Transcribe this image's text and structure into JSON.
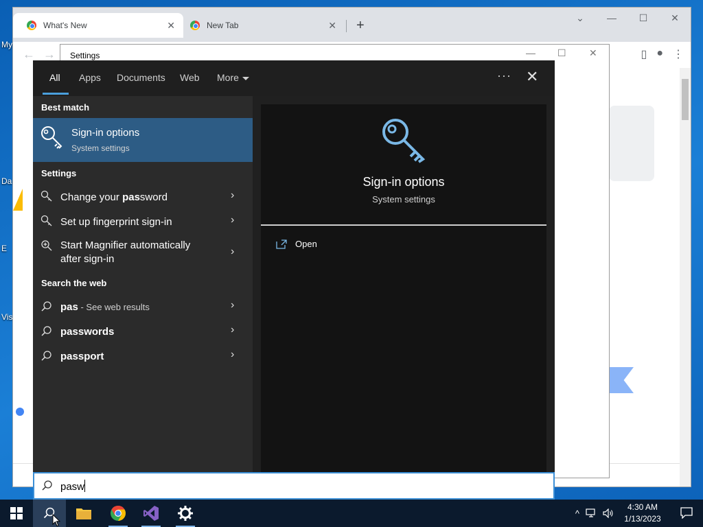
{
  "desktop": {
    "icon_labels": [
      "My",
      "Da",
      "E",
      "Vis"
    ]
  },
  "chrome": {
    "tabs": [
      {
        "title": "What's New",
        "active": true
      },
      {
        "title": "New Tab",
        "active": false
      }
    ],
    "new_tab_symbol": "+",
    "tab_close_symbol": "✕"
  },
  "settings_window": {
    "title": "Settings"
  },
  "search": {
    "filters": [
      {
        "label": "All",
        "active": true
      },
      {
        "label": "Apps"
      },
      {
        "label": "Documents"
      },
      {
        "label": "Web"
      },
      {
        "label": "More"
      }
    ],
    "more_options": "···",
    "close_symbol": "✕",
    "best_match_heading": "Best match",
    "best_match": {
      "title": "Sign-in options",
      "subtitle": "System settings"
    },
    "settings_heading": "Settings",
    "settings_results": [
      {
        "prefix": "Change your ",
        "bold": "pas",
        "suffix": "sword"
      },
      {
        "prefix": "Set up fingerprint sign-in",
        "bold": "",
        "suffix": ""
      },
      {
        "line1": "Start Magnifier automatically",
        "line2": "after sign-in"
      }
    ],
    "web_heading": "Search the web",
    "web_results": [
      {
        "bold": "pas",
        "dim": " - See web results"
      },
      {
        "bold": "passwords"
      },
      {
        "bold": "passport"
      }
    ],
    "preview": {
      "title": "Sign-in options",
      "subtitle": "System settings",
      "action": "Open"
    },
    "query": "pasw",
    "chevron": "›"
  },
  "taskbar": {
    "apps": [
      "start-button",
      "search-button",
      "file-explorer",
      "google-chrome",
      "visual-studio",
      "settings"
    ],
    "clock_time": "4:30 AM",
    "clock_date": "1/13/2023",
    "tray_chevron": "^"
  },
  "colors": {
    "accent": "#2d5c85",
    "search_border": "#3c8fd6",
    "panel_bg": "#202020",
    "taskbar_bg": "#0b1a2d"
  }
}
